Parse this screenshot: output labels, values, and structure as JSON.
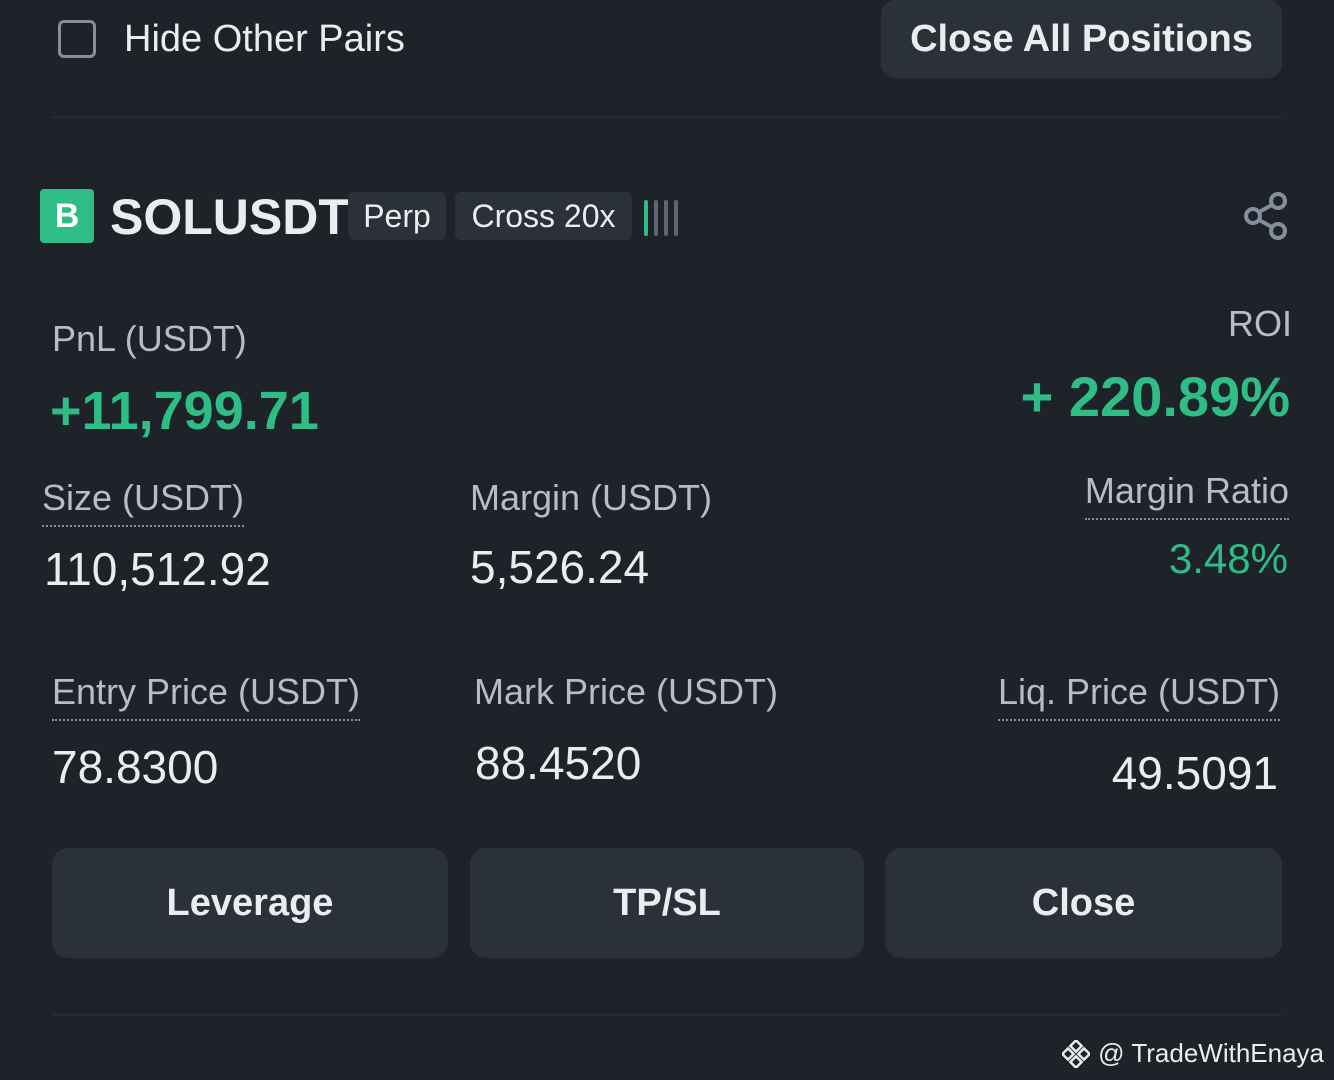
{
  "colors": {
    "background": "#1e2329",
    "surface": "#2b3139",
    "positive": "#2ebd85",
    "text_primary": "#eaecef",
    "text_secondary": "#b7bdc6"
  },
  "top_bar": {
    "hide_other_pairs_label": "Hide Other Pairs",
    "hide_other_pairs_checked": false,
    "close_all_label": "Close All Positions"
  },
  "position": {
    "side_badge": "B",
    "symbol": "SOLUSDT",
    "type_tag": "Perp",
    "margin_tag": "Cross 20x",
    "risk_icon": "risk-level-bars-icon",
    "share_icon": "share-icon",
    "pnl": {
      "label": "PnL (USDT)",
      "value": "+11,799.71"
    },
    "roi": {
      "label": "ROI",
      "value": "+ 220.89%"
    },
    "size": {
      "label": "Size (USDT)",
      "value": "110,512.92"
    },
    "margin": {
      "label": "Margin (USDT)",
      "value": "5,526.24"
    },
    "margin_ratio": {
      "label": "Margin Ratio",
      "value": "3.48%"
    },
    "entry_price": {
      "label": "Entry Price (USDT)",
      "value": "78.8300"
    },
    "mark_price": {
      "label": "Mark Price (USDT)",
      "value": "88.4520"
    },
    "liq_price": {
      "label": "Liq. Price (USDT)",
      "value": "49.5091"
    }
  },
  "actions": {
    "leverage_label": "Leverage",
    "tpsl_label": "TP/SL",
    "close_label": "Close"
  },
  "watermark": {
    "icon": "binance-logo-icon",
    "text": "@ TradeWithEnaya"
  }
}
